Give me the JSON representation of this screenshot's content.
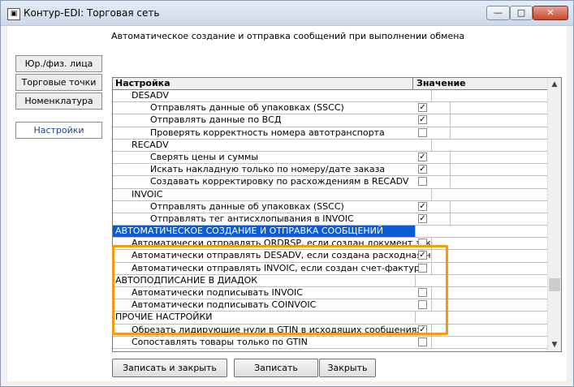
{
  "window": {
    "title": "Контур-EDI: Торговая сеть",
    "icon": "app-document-icon",
    "min_glyph": "—",
    "max_glyph": "□",
    "close_glyph": "✕"
  },
  "description": "Автоматическое создание и отправка сообщений при выполнении обмена",
  "nav": {
    "legal": "Юр./физ. лица",
    "stores": "Торговые точки",
    "nomenclature": "Номенклатура",
    "settings": "Настройки"
  },
  "grid": {
    "col_setting": "Настройка",
    "col_value": "Значение",
    "rows": [
      {
        "label": "DESADV",
        "level": 1,
        "checkbox": false,
        "checked": false,
        "selected": false
      },
      {
        "label": "Отправлять данные об упаковках (SSCC)",
        "level": 2,
        "checkbox": true,
        "checked": true,
        "selected": false
      },
      {
        "label": "Отправлять данные по ВСД",
        "level": 2,
        "checkbox": true,
        "checked": true,
        "selected": false
      },
      {
        "label": "Проверять корректность номера автотранспорта",
        "level": 2,
        "checkbox": true,
        "checked": false,
        "selected": false
      },
      {
        "label": "RECADV",
        "level": 1,
        "checkbox": false,
        "checked": false,
        "selected": false
      },
      {
        "label": "Сверять цены и суммы",
        "level": 2,
        "checkbox": true,
        "checked": true,
        "selected": false
      },
      {
        "label": "Искать накладную только по номеру/дате заказа",
        "level": 2,
        "checkbox": true,
        "checked": true,
        "selected": false
      },
      {
        "label": "Создавать корректировку по расхождениям в RECADV",
        "level": 2,
        "checkbox": true,
        "checked": false,
        "selected": false
      },
      {
        "label": "INVOIC",
        "level": 1,
        "checkbox": false,
        "checked": false,
        "selected": false
      },
      {
        "label": "Отправлять данные об упаковках (SSCC)",
        "level": 2,
        "checkbox": true,
        "checked": true,
        "selected": false
      },
      {
        "label": "Отправлять тег антисхлопывания в INVOIC",
        "level": 2,
        "checkbox": true,
        "checked": true,
        "selected": false
      },
      {
        "label": "АВТОМАТИЧЕСКОЕ СОЗДАНИЕ И ОТПРАВКА СООБЩЕНИЙ",
        "level": 0,
        "checkbox": false,
        "checked": false,
        "selected": true
      },
      {
        "label": "Автоматически отправлять ORDRSP, если создан документ заказ",
        "level": 1,
        "checkbox": true,
        "checked": false,
        "selected": false
      },
      {
        "label": "Автоматически отправлять DESADV, если создана расходная накл",
        "level": 1,
        "checkbox": true,
        "checked": true,
        "selected": false
      },
      {
        "label": "Автоматически отправлять INVOIC, если создан счет-фактура",
        "level": 1,
        "checkbox": true,
        "checked": false,
        "selected": false
      },
      {
        "label": "АВТОПОДПИСАНИЕ В ДИАДОК",
        "level": 0,
        "checkbox": false,
        "checked": false,
        "selected": false
      },
      {
        "label": "Автоматически подписывать INVOIC",
        "level": 1,
        "checkbox": true,
        "checked": false,
        "selected": false
      },
      {
        "label": "Автоматически подписывать COINVOIC",
        "level": 1,
        "checkbox": true,
        "checked": false,
        "selected": false
      },
      {
        "label": "ПРОЧИЕ НАСТРОЙКИ",
        "level": 0,
        "checkbox": false,
        "checked": false,
        "selected": false
      },
      {
        "label": "Обрезать лидирующие нули в GTIN в исходящих сообщениях",
        "level": 1,
        "checkbox": true,
        "checked": true,
        "selected": false
      },
      {
        "label": "Сопоставлять товары только по GTIN",
        "level": 1,
        "checkbox": true,
        "checked": false,
        "selected": false
      }
    ]
  },
  "buttons": {
    "save_close": "Записать и закрыть",
    "save": "Записать",
    "close": "Закрыть"
  },
  "colors": {
    "selection": "#0a5bd6",
    "highlight_frame": "#f39c12"
  }
}
